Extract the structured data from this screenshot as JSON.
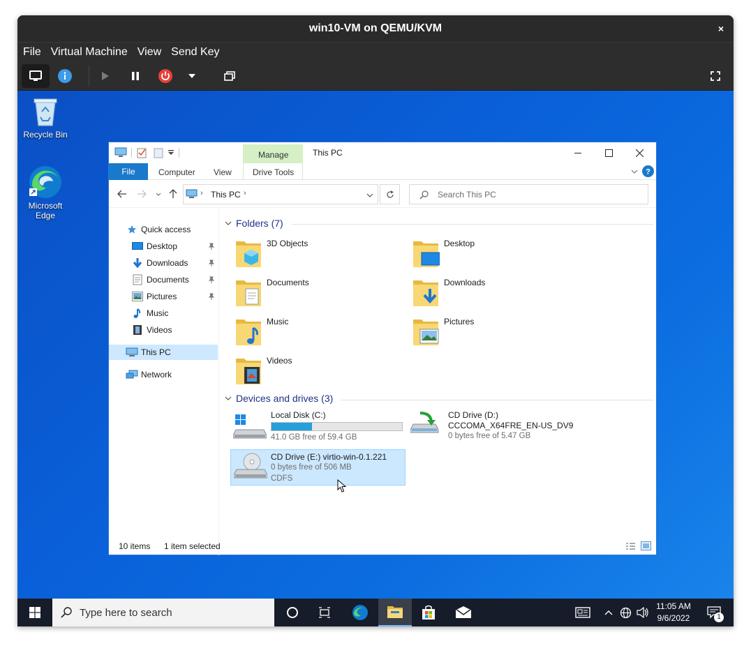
{
  "vm": {
    "title": "win10-VM on QEMU/KVM",
    "close": "×",
    "menu": [
      "File",
      "Virtual Machine",
      "View",
      "Send Key"
    ]
  },
  "desktop": {
    "icons": [
      {
        "label": "Recycle Bin"
      },
      {
        "label_line1": "Microsoft",
        "label_line2": "Edge"
      }
    ]
  },
  "explorer": {
    "title": "This PC",
    "manage_tab": "Manage",
    "tabs": {
      "file": "File",
      "computer": "Computer",
      "view": "View",
      "drive_tools": "Drive Tools"
    },
    "address": {
      "location": "This PC"
    },
    "search": {
      "placeholder": "Search This PC"
    },
    "nav": {
      "quick_access": "Quick access",
      "items": [
        {
          "label": "Desktop"
        },
        {
          "label": "Downloads"
        },
        {
          "label": "Documents"
        },
        {
          "label": "Pictures"
        },
        {
          "label": "Music"
        },
        {
          "label": "Videos"
        }
      ],
      "this_pc": "This PC",
      "network": "Network"
    },
    "folders_header": "Folders (7)",
    "folders": [
      {
        "label": "3D Objects"
      },
      {
        "label": "Desktop"
      },
      {
        "label": "Documents"
      },
      {
        "label": "Downloads"
      },
      {
        "label": "Music"
      },
      {
        "label": "Pictures"
      },
      {
        "label": "Videos"
      }
    ],
    "drives_header": "Devices and drives (3)",
    "drives": [
      {
        "name": "Local Disk (C:)",
        "free": "41.0 GB free of 59.4 GB",
        "used_fraction": 0.31
      },
      {
        "name": "CD Drive (D:)",
        "line2": "CCCOMA_X64FRE_EN-US_DV9",
        "free": "0 bytes free of 5.47 GB"
      },
      {
        "name": "CD Drive (E:) virtio-win-0.1.221",
        "free": "0 bytes free of 506 MB",
        "fs": "CDFS"
      }
    ],
    "status": {
      "items": "10 items",
      "selected": "1 item selected"
    }
  },
  "taskbar": {
    "search_placeholder": "Type here to search",
    "time": "11:05 AM",
    "date": "9/6/2022",
    "notification_count": "1"
  }
}
